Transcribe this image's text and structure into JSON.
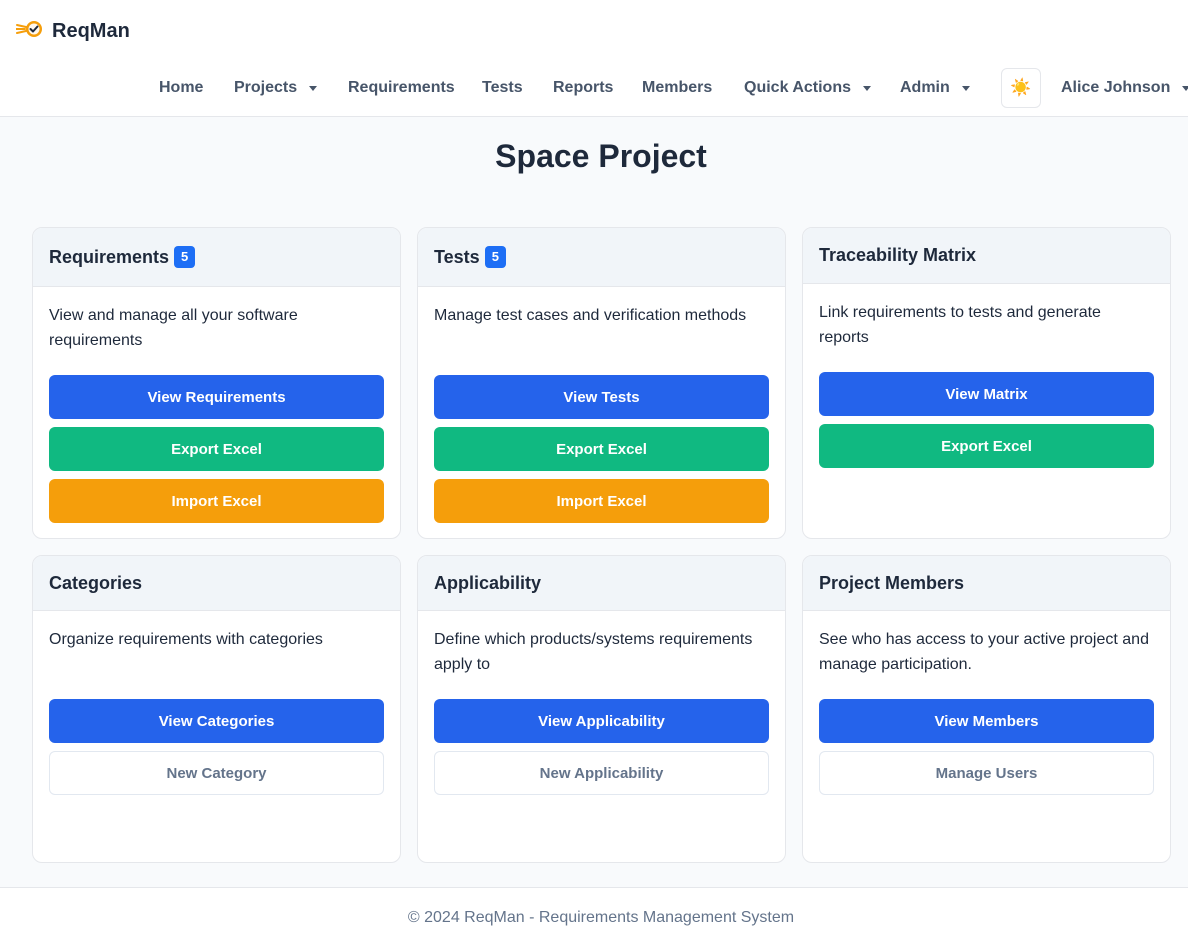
{
  "brand": {
    "name": "ReqMan",
    "logo_icon": "rocket-check-icon"
  },
  "nav": {
    "items": [
      {
        "label": "Home",
        "dropdown": false
      },
      {
        "label": "Projects",
        "dropdown": true
      },
      {
        "label": "Requirements",
        "dropdown": false
      },
      {
        "label": "Tests",
        "dropdown": false
      },
      {
        "label": "Reports",
        "dropdown": false
      },
      {
        "label": "Members",
        "dropdown": false
      },
      {
        "label": "Quick Actions",
        "dropdown": true
      },
      {
        "label": "Admin",
        "dropdown": true
      }
    ],
    "theme_icon": "☀️",
    "user": "Alice Johnson"
  },
  "page": {
    "title": "Space Project"
  },
  "cards": {
    "requirements": {
      "title": "Requirements",
      "badge": "5",
      "text": "View and manage all your software requirements",
      "buttons": [
        "View Requirements",
        "Export Excel",
        "Import Excel"
      ]
    },
    "tests": {
      "title": "Tests",
      "badge": "5",
      "text": "Manage test cases and verification methods",
      "buttons": [
        "View Tests",
        "Export Excel",
        "Import Excel"
      ]
    },
    "traceability": {
      "title": "Traceability Matrix",
      "text": "Link requirements to tests and generate reports",
      "buttons": [
        "View Matrix",
        "Export Excel"
      ]
    },
    "categories": {
      "title": "Categories",
      "text": "Organize requirements with categories",
      "buttons": [
        "View Categories",
        "New Category"
      ]
    },
    "applicability": {
      "title": "Applicability",
      "text": "Define which products/systems requirements apply to",
      "buttons": [
        "View Applicability",
        "New Applicability"
      ]
    },
    "members": {
      "title": "Project Members",
      "text": "See who has access to your active project and manage participation.",
      "buttons": [
        "View Members",
        "Manage Users"
      ]
    }
  },
  "footer": {
    "text": "© 2024 ReqMan - Requirements Management System"
  },
  "colors": {
    "primary": "#2563eb",
    "success": "#10b981",
    "warning": "#f59e0b",
    "badge": "#1d6ef5",
    "text": "#1e293b",
    "muted": "#475569"
  }
}
